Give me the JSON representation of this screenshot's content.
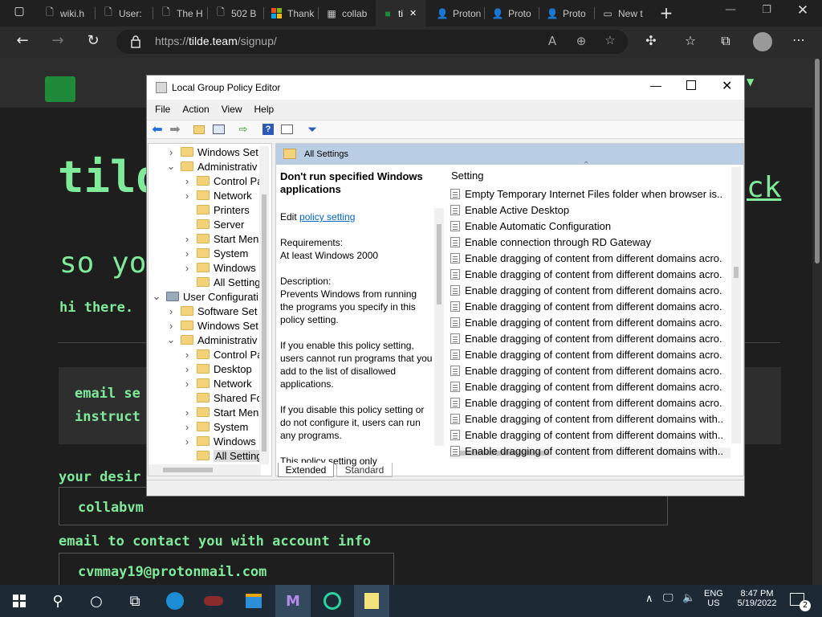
{
  "browser": {
    "tabs": [
      {
        "label": "wiki.h",
        "icon": "document-icon"
      },
      {
        "label": "User:",
        "icon": "document-icon"
      },
      {
        "label": "The H",
        "icon": "document-icon"
      },
      {
        "label": "502 B",
        "icon": "document-icon"
      },
      {
        "label": "Thank",
        "icon": "microsoft-icon"
      },
      {
        "label": "collab",
        "icon": "collab-icon"
      },
      {
        "label": "ti",
        "icon": "tilde-icon",
        "active": true
      },
      {
        "label": "Proton",
        "icon": "person-icon"
      },
      {
        "label": "Proto",
        "icon": "person-icon"
      },
      {
        "label": "Proto",
        "icon": "person-icon"
      },
      {
        "label": "New t",
        "icon": "newtab-icon"
      }
    ],
    "url_prefix": "https://",
    "url_host": "tilde.team",
    "url_path": "/signup/"
  },
  "page": {
    "heading_partial": "tild",
    "heading_right": "ck",
    "subheading_partial": "so yo",
    "greeting_partial": "hi there.",
    "box_line1": "email se",
    "box_line2": "instruct",
    "username_label_partial": "your desir",
    "username_value": "collabvm",
    "email_label": "email to contact you with account info",
    "email_value": "cvmmay19@protonmail.com"
  },
  "gpe": {
    "title": "Local Group Policy Editor",
    "menu": [
      "File",
      "Action",
      "View",
      "Help"
    ],
    "tree": [
      {
        "label": "Windows Set",
        "level": 1,
        "chev": ">"
      },
      {
        "label": "Administrativ",
        "level": 1,
        "chev": "v"
      },
      {
        "label": "Control Pa",
        "level": 2,
        "chev": ">"
      },
      {
        "label": "Network",
        "level": 2,
        "chev": ">"
      },
      {
        "label": "Printers",
        "level": 2,
        "chev": ""
      },
      {
        "label": "Server",
        "level": 2,
        "chev": ""
      },
      {
        "label": "Start Men",
        "level": 2,
        "chev": ">"
      },
      {
        "label": "System",
        "level": 2,
        "chev": ">"
      },
      {
        "label": "Windows",
        "level": 2,
        "chev": ">"
      },
      {
        "label": "All Setting",
        "level": 2,
        "chev": ""
      },
      {
        "label": "User Configurati",
        "level": 0,
        "chev": "v"
      },
      {
        "label": "Software Set",
        "level": 1,
        "chev": ">"
      },
      {
        "label": "Windows Set",
        "level": 1,
        "chev": ">"
      },
      {
        "label": "Administrativ",
        "level": 1,
        "chev": "v"
      },
      {
        "label": "Control Pa",
        "level": 2,
        "chev": ">"
      },
      {
        "label": "Desktop",
        "level": 2,
        "chev": ">"
      },
      {
        "label": "Network",
        "level": 2,
        "chev": ">"
      },
      {
        "label": "Shared Fo",
        "level": 2,
        "chev": ""
      },
      {
        "label": "Start Men",
        "level": 2,
        "chev": ">"
      },
      {
        "label": "System",
        "level": 2,
        "chev": ">"
      },
      {
        "label": "Windows",
        "level": 2,
        "chev": ">"
      },
      {
        "label": "All Setting",
        "level": 2,
        "chev": "",
        "selected": true
      }
    ],
    "panel_header": "All Settings",
    "desc": {
      "title": "Don't run specified Windows applications",
      "edit_prefix": "Edit",
      "edit_link": "policy setting",
      "req_label": "Requirements:",
      "req_value": "At least Windows 2000",
      "desc_label": "Description:",
      "p1": "Prevents Windows from running the programs you specify in this policy setting.",
      "p2": "If you enable this policy setting, users cannot run programs that you add to the list of disallowed applications.",
      "p3": "If you disable this policy setting or do not configure it, users can run any programs.",
      "p4": "This policy setting only"
    },
    "column_header": "Setting",
    "settings": [
      "Empty Temporary Internet Files folder when browser is...",
      "Enable Active Desktop",
      "Enable Automatic Configuration",
      "Enable connection through RD Gateway",
      "Enable dragging of content from different domains acro...",
      "Enable dragging of content from different domains acro...",
      "Enable dragging of content from different domains acro...",
      "Enable dragging of content from different domains acro...",
      "Enable dragging of content from different domains acro...",
      "Enable dragging of content from different domains acro...",
      "Enable dragging of content from different domains acro...",
      "Enable dragging of content from different domains acro...",
      "Enable dragging of content from different domains acro...",
      "Enable dragging of content from different domains acro...",
      "Enable dragging of content from different domains with...",
      "Enable dragging of content from different domains with...",
      "Enable dragging of content from different domains with..."
    ],
    "tabs": [
      "Extended",
      "Standard"
    ]
  },
  "taskbar": {
    "lang1": "ENG",
    "lang2": "US",
    "time": "8:47 PM",
    "date": "5/19/2022",
    "notif_count": "2"
  },
  "colors": {
    "accent_green": "#7eea9a",
    "link_blue": "#0066cc",
    "panel_header_blue": "#b9cde5",
    "taskbar": "#1d2a36"
  }
}
